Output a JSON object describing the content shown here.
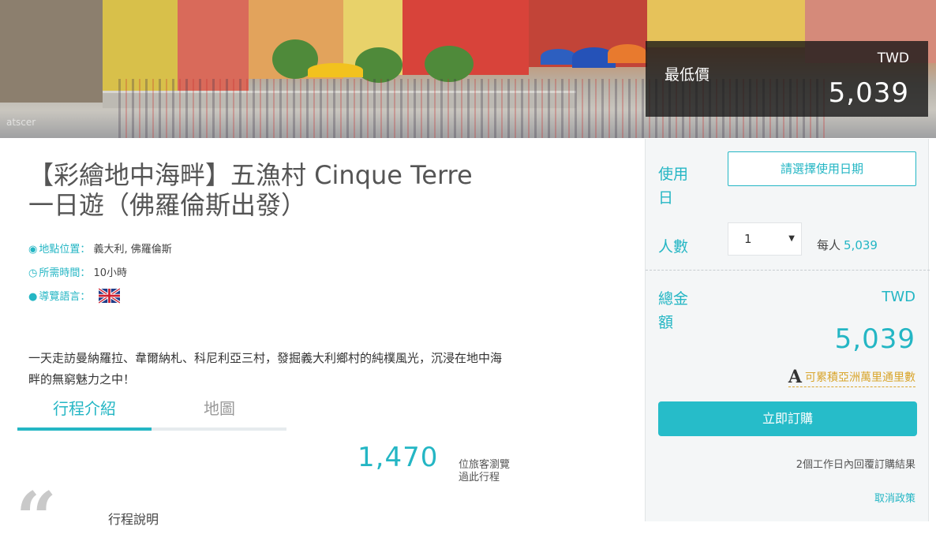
{
  "hero": {
    "watermark": "atscer",
    "price_label": "最低價",
    "currency": "TWD",
    "price": "5,039"
  },
  "product": {
    "title_line1": "【彩繪地中海畔】五漁村 Cinque Terre",
    "title_line2": "一日遊（佛羅倫斯出發）",
    "location_label": "地點位置：",
    "location_value": "義大利, 佛羅倫斯",
    "duration_label": "所需時間：",
    "duration_value": "10小時",
    "language_label": "導覽語言：",
    "language_flag_icon": "uk-flag-icon",
    "description_line1": "一天走訪曼納羅拉、韋爾納札、科尼利亞三村，發掘義大利鄉村的純樸風光，沉浸在地中海",
    "description_line2": "畔的無窮魅力之中！"
  },
  "tabs": [
    {
      "label": "行程介紹",
      "active": true
    },
    {
      "label": "地圖",
      "active": false
    }
  ],
  "stats": {
    "views": "1,470",
    "views_label_line1": "位旅客瀏覽",
    "views_label_line2": "過此行程"
  },
  "itinerary": {
    "quote_icon": "quote-icon",
    "section_label": "行程說明"
  },
  "booking": {
    "date_label_line1": "使用",
    "date_label_line2": "日",
    "date_button": "請選擇使用日期",
    "people_label": "人數",
    "quantity": "1",
    "per_person_label": "每人",
    "per_person_price": "5,039",
    "total_label_line1": "總金",
    "total_label_line2": "額",
    "total_currency": "TWD",
    "total_price": "5,039",
    "miles_text": "可累積亞洲萬里通里數",
    "buy_button": "立即訂購",
    "reply_note": "2個工作日內回覆訂購結果",
    "cancel_policy": "取消政策"
  },
  "colors": {
    "accent": "#24b6c4",
    "button": "#26bcc9",
    "miles": "#d9a52c"
  }
}
